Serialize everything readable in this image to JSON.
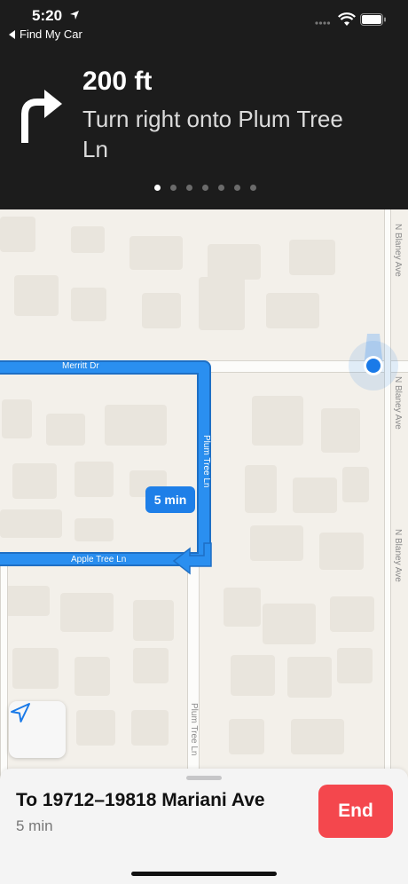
{
  "status_bar": {
    "time": "5:20",
    "back_label": "Find My Car"
  },
  "navigation": {
    "distance": "200 ft",
    "instruction": "Turn right onto Plum Tree Ln",
    "page_count": 7,
    "active_page": 1
  },
  "map": {
    "streets": {
      "merritt": "Merritt Dr",
      "plum_route": "Plum Tree Ln",
      "apple": "Apple Tree Ln",
      "plum_lower": "Plum Tree Ln",
      "blaney_1": "N Blaney Ave",
      "blaney_2": "N Blaney Ave",
      "blaney_3": "N Blaney Ave"
    },
    "eta_bubble": "5 min",
    "route_color": "#2a8ff0",
    "location_color": "#1a7ae8"
  },
  "bottom_sheet": {
    "destination": "To 19712–19818 Mariani Ave",
    "eta": "5 min",
    "end_label": "End"
  }
}
